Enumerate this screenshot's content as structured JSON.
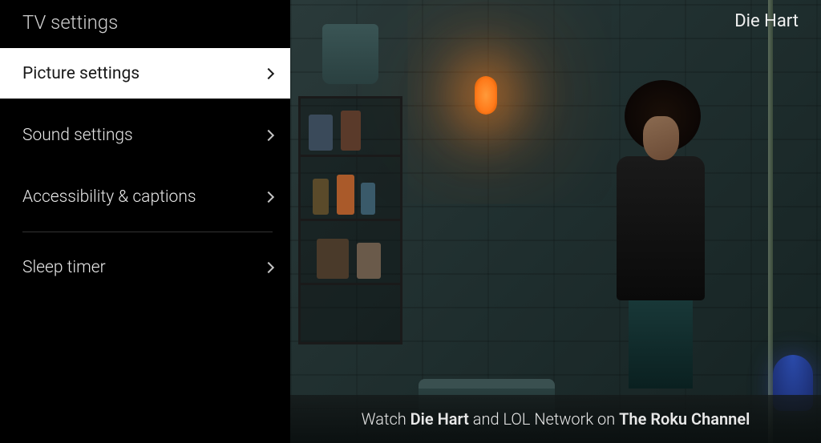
{
  "sidebar": {
    "title": "TV settings",
    "items": [
      {
        "label": "Picture settings",
        "selected": true
      },
      {
        "label": "Sound settings",
        "selected": false
      },
      {
        "label": "Accessibility & captions",
        "selected": false
      },
      {
        "label": "Sleep timer",
        "selected": false
      }
    ]
  },
  "content": {
    "title": "Die Hart"
  },
  "promo": {
    "prefix": "Watch ",
    "title": "Die Hart",
    "mid": " and LOL Network on ",
    "channel": "The Roku Channel"
  }
}
